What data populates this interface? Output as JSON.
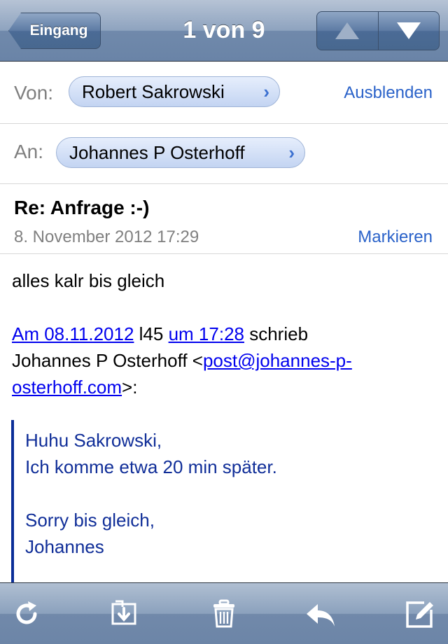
{
  "nav": {
    "back_label": "Eingang",
    "title": "1 von 9",
    "up_icon": "arrow-up-icon",
    "down_icon": "arrow-down-icon"
  },
  "header": {
    "from_label": "Von:",
    "from_name": "Robert Sakrowski",
    "hide_label": "Ausblenden",
    "to_label": "An:",
    "to_name": "Johannes P Osterhoff",
    "subject": "Re: Anfrage :-)",
    "date": "8. November 2012 17:29",
    "mark_label": "Markieren"
  },
  "body": {
    "line1": "alles kalr bis gleich",
    "attrib_link1": "Am 08.11.2012",
    "attrib_mid": " l45 ",
    "attrib_link2": "um 17:28",
    "attrib_after": " schrieb",
    "attrib_name": "Johannes P Osterhoff <",
    "attrib_email_part1": "post@johannes-p-",
    "attrib_email_part2": "osterhoff.com",
    "attrib_end": ">:"
  },
  "quote": {
    "line1": "Huhu Sakrowski,",
    "line2": "Ich komme etwa 20 min später.",
    "line3": "Sorry bis gleich,",
    "line4": "Johannes"
  },
  "toolbar": {
    "icons": [
      "refresh-icon",
      "move-folder-icon",
      "trash-icon",
      "reply-icon",
      "compose-icon"
    ]
  },
  "colors": {
    "link": "#2a62c9",
    "quote_text": "#102e98",
    "quote_bar": "#0b2e98",
    "navbar": "#6a84a7"
  }
}
